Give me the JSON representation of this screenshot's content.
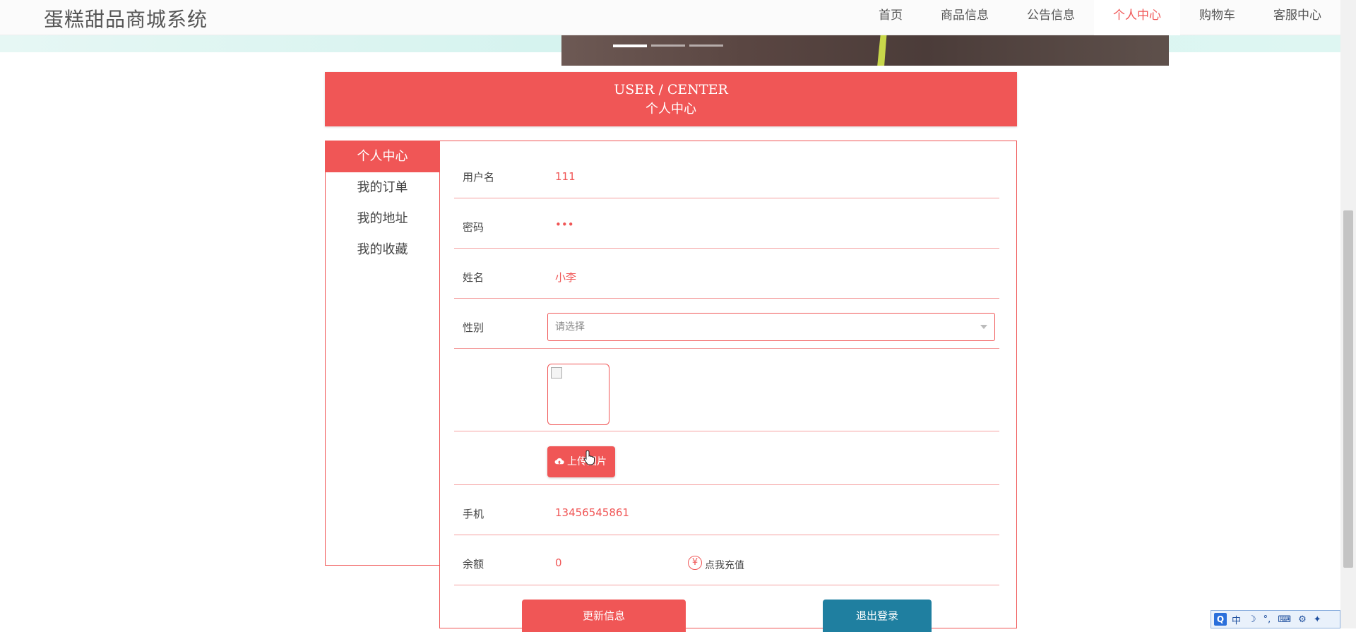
{
  "site": {
    "title": "蛋糕甜品商城系统"
  },
  "nav": {
    "items": [
      {
        "label": "首页",
        "active": false
      },
      {
        "label": "商品信息",
        "active": false
      },
      {
        "label": "公告信息",
        "active": false
      },
      {
        "label": "个人中心",
        "active": true
      },
      {
        "label": "购物车",
        "active": false
      },
      {
        "label": "客服中心",
        "active": false
      }
    ]
  },
  "banner": {
    "slides": 3,
    "active_slide": 1
  },
  "header": {
    "en": "USER / CENTER",
    "cn": "个人中心"
  },
  "sidebar": {
    "items": [
      {
        "label": "个人中心",
        "active": true
      },
      {
        "label": "我的订单",
        "active": false
      },
      {
        "label": "我的地址",
        "active": false
      },
      {
        "label": "我的收藏",
        "active": false
      }
    ]
  },
  "form": {
    "username": {
      "label": "用户名",
      "value": "111"
    },
    "password": {
      "label": "密码",
      "value": "•••"
    },
    "name": {
      "label": "姓名",
      "value": "小李"
    },
    "gender": {
      "label": "性别",
      "placeholder": "请选择"
    },
    "upload": {
      "label": "上传图片",
      "icon": "cloud-upload-icon"
    },
    "phone": {
      "label": "手机",
      "value": "13456545861"
    },
    "balance": {
      "label": "余额",
      "value": "0",
      "recharge_label": "点我充值",
      "currency_symbol": "¥"
    }
  },
  "actions": {
    "update_label": "更新信息",
    "logout_label": "退出登录"
  },
  "colors": {
    "accent": "#f05656",
    "logout": "#1f7fa0",
    "nav_active": "#f05656"
  },
  "ime": {
    "logo": "Q",
    "mode": "中",
    "items": [
      "☽",
      "°,",
      "⌨",
      "⚙",
      "✦"
    ]
  }
}
